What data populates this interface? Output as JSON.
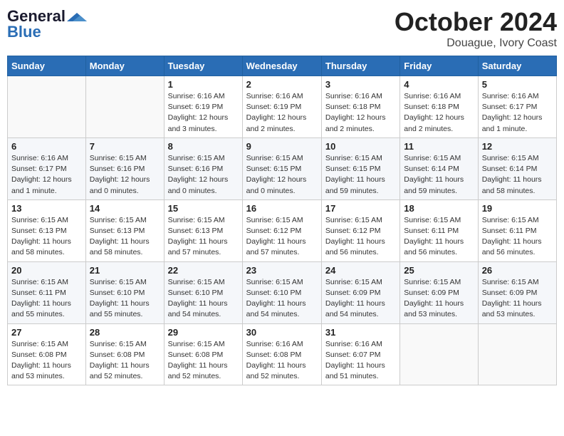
{
  "header": {
    "logo_general": "General",
    "logo_blue": "Blue",
    "month": "October 2024",
    "location": "Douague, Ivory Coast"
  },
  "weekdays": [
    "Sunday",
    "Monday",
    "Tuesday",
    "Wednesday",
    "Thursday",
    "Friday",
    "Saturday"
  ],
  "weeks": [
    [
      {
        "day": "",
        "info": ""
      },
      {
        "day": "",
        "info": ""
      },
      {
        "day": "1",
        "info": "Sunrise: 6:16 AM\nSunset: 6:19 PM\nDaylight: 12 hours\nand 3 minutes."
      },
      {
        "day": "2",
        "info": "Sunrise: 6:16 AM\nSunset: 6:19 PM\nDaylight: 12 hours\nand 2 minutes."
      },
      {
        "day": "3",
        "info": "Sunrise: 6:16 AM\nSunset: 6:18 PM\nDaylight: 12 hours\nand 2 minutes."
      },
      {
        "day": "4",
        "info": "Sunrise: 6:16 AM\nSunset: 6:18 PM\nDaylight: 12 hours\nand 2 minutes."
      },
      {
        "day": "5",
        "info": "Sunrise: 6:16 AM\nSunset: 6:17 PM\nDaylight: 12 hours\nand 1 minute."
      }
    ],
    [
      {
        "day": "6",
        "info": "Sunrise: 6:16 AM\nSunset: 6:17 PM\nDaylight: 12 hours\nand 1 minute."
      },
      {
        "day": "7",
        "info": "Sunrise: 6:15 AM\nSunset: 6:16 PM\nDaylight: 12 hours\nand 0 minutes."
      },
      {
        "day": "8",
        "info": "Sunrise: 6:15 AM\nSunset: 6:16 PM\nDaylight: 12 hours\nand 0 minutes."
      },
      {
        "day": "9",
        "info": "Sunrise: 6:15 AM\nSunset: 6:15 PM\nDaylight: 12 hours\nand 0 minutes."
      },
      {
        "day": "10",
        "info": "Sunrise: 6:15 AM\nSunset: 6:15 PM\nDaylight: 11 hours\nand 59 minutes."
      },
      {
        "day": "11",
        "info": "Sunrise: 6:15 AM\nSunset: 6:14 PM\nDaylight: 11 hours\nand 59 minutes."
      },
      {
        "day": "12",
        "info": "Sunrise: 6:15 AM\nSunset: 6:14 PM\nDaylight: 11 hours\nand 58 minutes."
      }
    ],
    [
      {
        "day": "13",
        "info": "Sunrise: 6:15 AM\nSunset: 6:13 PM\nDaylight: 11 hours\nand 58 minutes."
      },
      {
        "day": "14",
        "info": "Sunrise: 6:15 AM\nSunset: 6:13 PM\nDaylight: 11 hours\nand 58 minutes."
      },
      {
        "day": "15",
        "info": "Sunrise: 6:15 AM\nSunset: 6:13 PM\nDaylight: 11 hours\nand 57 minutes."
      },
      {
        "day": "16",
        "info": "Sunrise: 6:15 AM\nSunset: 6:12 PM\nDaylight: 11 hours\nand 57 minutes."
      },
      {
        "day": "17",
        "info": "Sunrise: 6:15 AM\nSunset: 6:12 PM\nDaylight: 11 hours\nand 56 minutes."
      },
      {
        "day": "18",
        "info": "Sunrise: 6:15 AM\nSunset: 6:11 PM\nDaylight: 11 hours\nand 56 minutes."
      },
      {
        "day": "19",
        "info": "Sunrise: 6:15 AM\nSunset: 6:11 PM\nDaylight: 11 hours\nand 56 minutes."
      }
    ],
    [
      {
        "day": "20",
        "info": "Sunrise: 6:15 AM\nSunset: 6:11 PM\nDaylight: 11 hours\nand 55 minutes."
      },
      {
        "day": "21",
        "info": "Sunrise: 6:15 AM\nSunset: 6:10 PM\nDaylight: 11 hours\nand 55 minutes."
      },
      {
        "day": "22",
        "info": "Sunrise: 6:15 AM\nSunset: 6:10 PM\nDaylight: 11 hours\nand 54 minutes."
      },
      {
        "day": "23",
        "info": "Sunrise: 6:15 AM\nSunset: 6:10 PM\nDaylight: 11 hours\nand 54 minutes."
      },
      {
        "day": "24",
        "info": "Sunrise: 6:15 AM\nSunset: 6:09 PM\nDaylight: 11 hours\nand 54 minutes."
      },
      {
        "day": "25",
        "info": "Sunrise: 6:15 AM\nSunset: 6:09 PM\nDaylight: 11 hours\nand 53 minutes."
      },
      {
        "day": "26",
        "info": "Sunrise: 6:15 AM\nSunset: 6:09 PM\nDaylight: 11 hours\nand 53 minutes."
      }
    ],
    [
      {
        "day": "27",
        "info": "Sunrise: 6:15 AM\nSunset: 6:08 PM\nDaylight: 11 hours\nand 53 minutes."
      },
      {
        "day": "28",
        "info": "Sunrise: 6:15 AM\nSunset: 6:08 PM\nDaylight: 11 hours\nand 52 minutes."
      },
      {
        "day": "29",
        "info": "Sunrise: 6:15 AM\nSunset: 6:08 PM\nDaylight: 11 hours\nand 52 minutes."
      },
      {
        "day": "30",
        "info": "Sunrise: 6:16 AM\nSunset: 6:08 PM\nDaylight: 11 hours\nand 52 minutes."
      },
      {
        "day": "31",
        "info": "Sunrise: 6:16 AM\nSunset: 6:07 PM\nDaylight: 11 hours\nand 51 minutes."
      },
      {
        "day": "",
        "info": ""
      },
      {
        "day": "",
        "info": ""
      }
    ]
  ]
}
